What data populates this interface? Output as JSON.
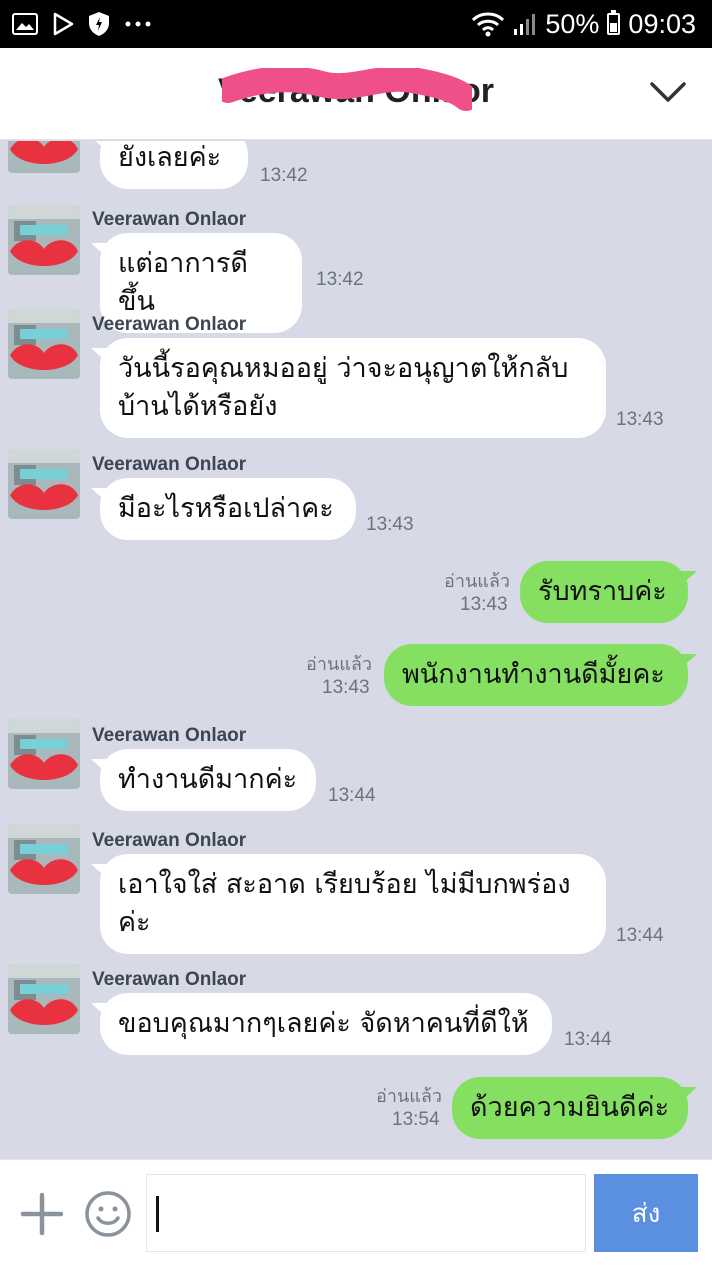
{
  "status_bar": {
    "battery_percent": "50%",
    "time": "09:03",
    "icons": [
      "image-icon",
      "play-store-icon",
      "shield-icon",
      "more-icon",
      "wifi-icon",
      "signal-icon",
      "battery-icon"
    ]
  },
  "header": {
    "title": "Veerawan Onlaor"
  },
  "messages": [
    {
      "sender": "",
      "text": "ยังเลยค่ะ",
      "time": "13:42",
      "dir": "in"
    },
    {
      "sender": "Veerawan Onlaor",
      "text": "แต่อาการดีขึ้น",
      "time": "13:42",
      "dir": "in"
    },
    {
      "sender": "Veerawan Onlaor",
      "text": "วันนี้รอคุณหมออยู่ ว่าจะอนุญาตให้กลับบ้านได้หรือยัง",
      "time": "13:43",
      "dir": "in"
    },
    {
      "sender": "Veerawan Onlaor",
      "text": "มีอะไรหรือเปล่าคะ",
      "time": "13:43",
      "dir": "in"
    },
    {
      "read": "อ่านแล้ว",
      "text": "รับทราบค่ะ",
      "time": "13:43",
      "dir": "out"
    },
    {
      "read": "อ่านแล้ว",
      "text": "พนักงานทำงานดีมั้ยคะ",
      "time": "13:43",
      "dir": "out"
    },
    {
      "sender": "Veerawan Onlaor",
      "text": "ทำงานดีมากค่ะ",
      "time": "13:44",
      "dir": "in"
    },
    {
      "sender": "Veerawan Onlaor",
      "text": "เอาใจใส่ สะอาด เรียบร้อย ไม่มีบกพร่องค่ะ",
      "time": "13:44",
      "dir": "in"
    },
    {
      "sender": "Veerawan Onlaor",
      "text": "ขอบคุณมากๆเลยค่ะ จัดหาคนที่ดีให้",
      "time": "13:44",
      "dir": "in"
    },
    {
      "read": "อ่านแล้ว",
      "text": "ด้วยความยินดีค่ะ",
      "time": "13:54",
      "dir": "out"
    }
  ],
  "input_bar": {
    "placeholder": "",
    "send_label": "ส่ง"
  },
  "colors": {
    "chat_background": "#d7dae6",
    "outgoing_bubble": "#85e062",
    "incoming_bubble": "#ffffff",
    "send_button": "#5b8fe0",
    "redaction": "#f0508a"
  }
}
